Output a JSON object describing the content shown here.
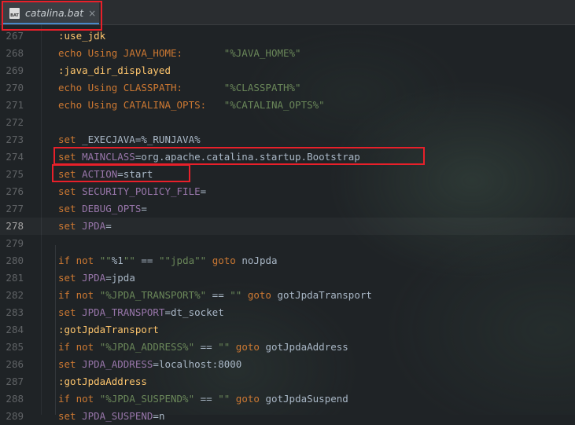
{
  "tab": {
    "label": "catalina.bat",
    "icon": "bat-file-icon",
    "icon_text": "BAT",
    "close": "×"
  },
  "colors": {
    "keyword": "#cc7832",
    "string": "#6a8759",
    "variable": "#9876aa",
    "label": "#ffc66d",
    "text": "#a9b7c6",
    "highlight": "#e8202a"
  },
  "lines": [
    {
      "n": "267",
      "t": [
        [
          "lbl",
          ":use_jdk"
        ]
      ]
    },
    {
      "n": "268",
      "t": [
        [
          "kw",
          "echo"
        ],
        [
          "kw",
          " Using JAVA_HOME:       "
        ],
        [
          "str",
          "\"%JAVA_HOME%\""
        ]
      ]
    },
    {
      "n": "269",
      "t": [
        [
          "lbl",
          ":java_dir_displayed"
        ]
      ]
    },
    {
      "n": "270",
      "t": [
        [
          "kw",
          "echo"
        ],
        [
          "kw",
          " Using CLASSPATH:       "
        ],
        [
          "str",
          "\"%CLASSPATH%\""
        ]
      ]
    },
    {
      "n": "271",
      "t": [
        [
          "kw",
          "echo"
        ],
        [
          "kw",
          " Using CATALINA_OPTS:   "
        ],
        [
          "str",
          "\"%CATALINA_OPTS%\""
        ]
      ]
    },
    {
      "n": "272",
      "t": []
    },
    {
      "n": "273",
      "t": [
        [
          "kw",
          "set"
        ],
        [
          "txt",
          " _EXECJAVA=%_RUNJAVA%"
        ]
      ]
    },
    {
      "n": "274",
      "t": [
        [
          "kw",
          "set"
        ],
        [
          "var",
          " MAINCLASS"
        ],
        [
          "txt",
          "=org.apache.catalina.startup.Bootstrap"
        ]
      ]
    },
    {
      "n": "275",
      "t": [
        [
          "kw",
          "set"
        ],
        [
          "var",
          " ACTION"
        ],
        [
          "txt",
          "=start"
        ]
      ]
    },
    {
      "n": "276",
      "t": [
        [
          "kw",
          "set"
        ],
        [
          "var",
          " SECURITY_POLICY_FILE"
        ],
        [
          "txt",
          "="
        ]
      ]
    },
    {
      "n": "277",
      "t": [
        [
          "kw",
          "set"
        ],
        [
          "var",
          " DEBUG_OPTS"
        ],
        [
          "txt",
          "="
        ]
      ]
    },
    {
      "n": "278",
      "t": [
        [
          "kw",
          "set"
        ],
        [
          "var",
          " JPDA"
        ],
        [
          "txt",
          "="
        ]
      ],
      "current": true
    },
    {
      "n": "279",
      "t": []
    },
    {
      "n": "280",
      "t": [
        [
          "kw",
          "if not "
        ],
        [
          "str",
          "\"\""
        ],
        [
          "txt",
          "%1"
        ],
        [
          "str",
          "\"\""
        ],
        [
          "txt",
          " == "
        ],
        [
          "str",
          "\"\"jpda\"\""
        ],
        [
          "kw",
          " goto"
        ],
        [
          "txt",
          " noJpda"
        ]
      ]
    },
    {
      "n": "281",
      "t": [
        [
          "kw",
          "set"
        ],
        [
          "var",
          " JPDA"
        ],
        [
          "txt",
          "=jpda"
        ]
      ]
    },
    {
      "n": "282",
      "t": [
        [
          "kw",
          "if not "
        ],
        [
          "str",
          "\"%JPDA_TRANSPORT%\""
        ],
        [
          "txt",
          " == "
        ],
        [
          "str",
          "\"\""
        ],
        [
          "kw",
          " goto"
        ],
        [
          "txt",
          " gotJpdaTransport"
        ]
      ]
    },
    {
      "n": "283",
      "t": [
        [
          "kw",
          "set"
        ],
        [
          "var",
          " JPDA_TRANSPORT"
        ],
        [
          "txt",
          "=dt_socket"
        ]
      ]
    },
    {
      "n": "284",
      "t": [
        [
          "lbl",
          ":gotJpdaTransport"
        ]
      ]
    },
    {
      "n": "285",
      "t": [
        [
          "kw",
          "if not "
        ],
        [
          "str",
          "\"%JPDA_ADDRESS%\""
        ],
        [
          "txt",
          " == "
        ],
        [
          "str",
          "\"\""
        ],
        [
          "kw",
          " goto"
        ],
        [
          "txt",
          " gotJpdaAddress"
        ]
      ]
    },
    {
      "n": "286",
      "t": [
        [
          "kw",
          "set"
        ],
        [
          "var",
          " JPDA_ADDRESS"
        ],
        [
          "txt",
          "=localhost:8000"
        ]
      ]
    },
    {
      "n": "287",
      "t": [
        [
          "lbl",
          ":gotJpdaAddress"
        ]
      ]
    },
    {
      "n": "288",
      "t": [
        [
          "kw",
          "if not "
        ],
        [
          "str",
          "\"%JPDA_SUSPEND%\""
        ],
        [
          "txt",
          " == "
        ],
        [
          "str",
          "\"\""
        ],
        [
          "kw",
          " goto"
        ],
        [
          "txt",
          " gotJpdaSuspend"
        ]
      ]
    },
    {
      "n": "289",
      "t": [
        [
          "kw",
          "set"
        ],
        [
          "var",
          " JPDA_SUSPEND"
        ],
        [
          "txt",
          "=n"
        ]
      ]
    }
  ]
}
